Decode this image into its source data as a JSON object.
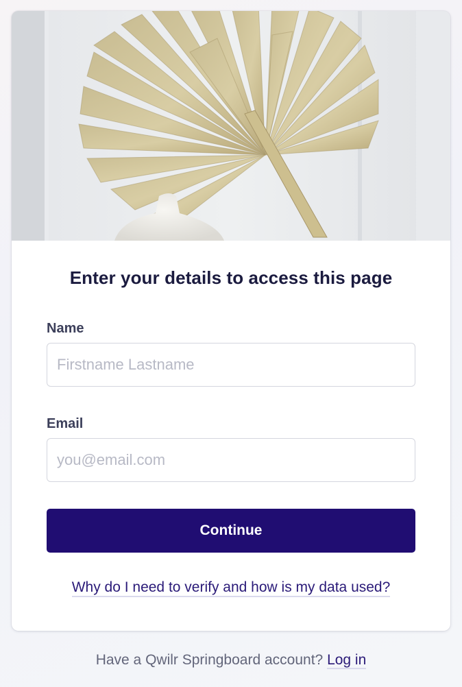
{
  "hero": {
    "image": "dried-palm-leaf-and-white-vase-photo"
  },
  "form": {
    "title": "Enter your details to access this page",
    "name_label": "Name",
    "name_placeholder": "Firstname Lastname",
    "name_value": "",
    "email_label": "Email",
    "email_placeholder": "you@email.com",
    "email_value": "",
    "continue_label": "Continue",
    "why_link": "Why do I need to verify and how is my data used?"
  },
  "footer": {
    "text": "Have a Qwilr Springboard account?",
    "login_link": "Log in"
  },
  "colors": {
    "primary": "#200d72",
    "heading": "#1b1b3f",
    "link": "#2a1a78"
  }
}
